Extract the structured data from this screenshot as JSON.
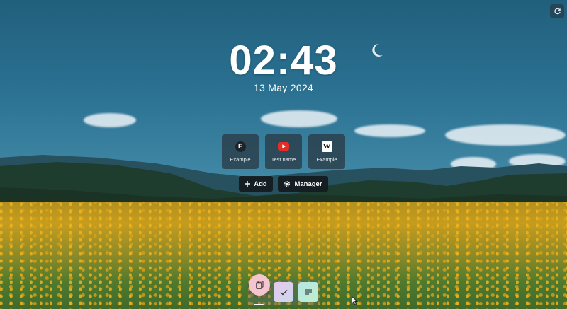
{
  "clock": {
    "time": "02:43",
    "date": "13 May 2024"
  },
  "shortcuts": [
    {
      "label": "Example",
      "icon": "e-letter-icon",
      "letter": "E"
    },
    {
      "label": "Test name",
      "icon": "youtube-icon"
    },
    {
      "label": "Example",
      "icon": "wikipedia-icon",
      "letter": "W"
    }
  ],
  "actions": {
    "add_label": "Add",
    "manager_label": "Manager"
  },
  "dock": {
    "items": [
      {
        "icon": "copy-icon",
        "color": "#f4c4cf"
      },
      {
        "icon": "check-icon",
        "color": "#c9d8ee"
      },
      {
        "icon": "notes-icon",
        "color": "#b9ecd6"
      }
    ]
  },
  "colors": {
    "accent_dark": "#14191e",
    "youtube_red": "#e52d27"
  }
}
